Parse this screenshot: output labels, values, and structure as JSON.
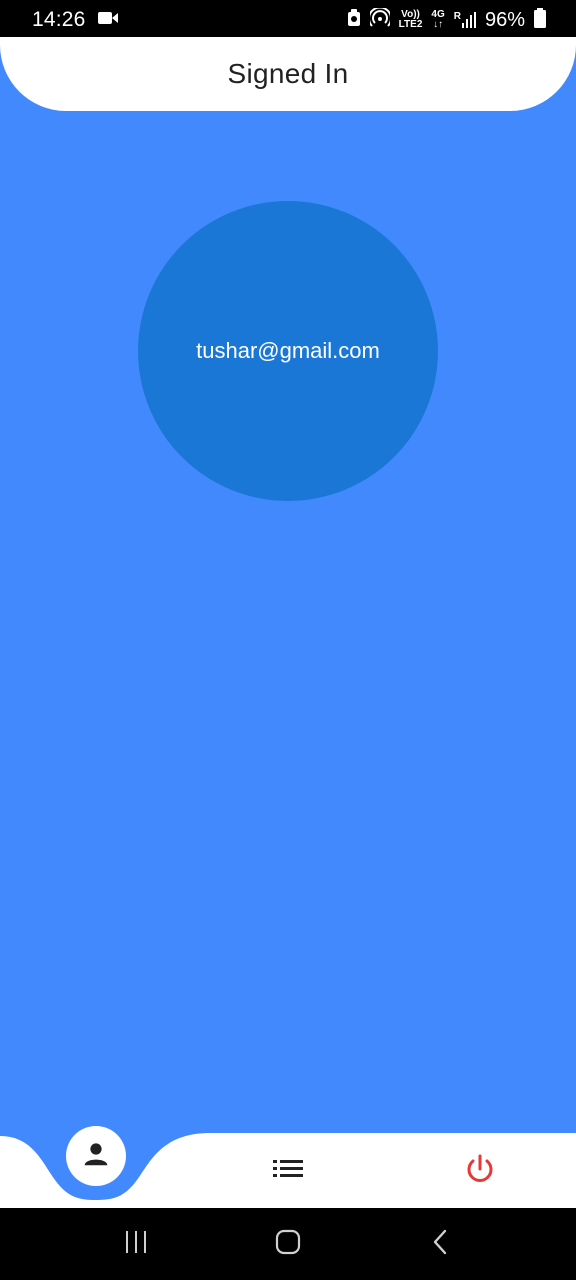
{
  "status_bar": {
    "time": "14:26",
    "volte_line1": "Vo))",
    "volte_line2": "LTE2",
    "network": "4G",
    "signal_label": "R",
    "battery": "96%",
    "icons": [
      "video-camera-icon",
      "notification-icon",
      "hotspot-icon",
      "volte-icon",
      "data-arrows-icon",
      "signal-icon",
      "battery-icon"
    ]
  },
  "header": {
    "title": "Signed In"
  },
  "profile": {
    "email": "tushar@gmail.com"
  },
  "bottom_nav": {
    "items": [
      {
        "icon": "person-icon",
        "active": true
      },
      {
        "icon": "list-icon",
        "active": false
      },
      {
        "icon": "power-icon",
        "active": false
      }
    ],
    "power_color": "#e53935"
  },
  "system_nav": {
    "icons": [
      "recent-apps-icon",
      "home-icon",
      "back-icon"
    ]
  },
  "colors": {
    "background": "#4289fd",
    "circle": "#1b77d6",
    "surface": "#ffffff"
  }
}
